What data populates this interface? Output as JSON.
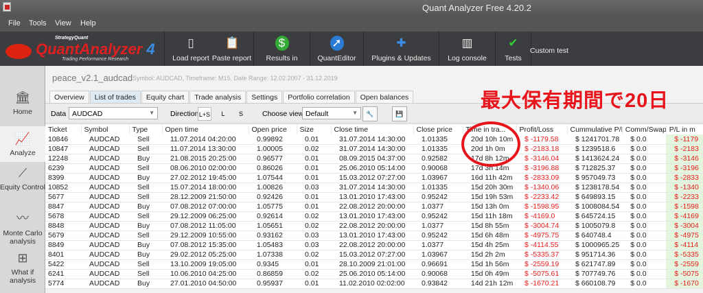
{
  "window": {
    "title": "Quant Analyzer Free 4.20.2"
  },
  "menu": [
    "File",
    "Tools",
    "View",
    "Help"
  ],
  "logo": {
    "top": "StrategyQuant",
    "main": "QuantAnalyzer",
    "version": "4",
    "sub": "Trading Performance   Research"
  },
  "toolbar": [
    {
      "label": "Load report",
      "icon": "load-report-icon"
    },
    {
      "label": "Paste report",
      "icon": "paste-report-icon"
    },
    {
      "label": "Results in",
      "icon": "dollar-icon"
    },
    {
      "label": "QuantEditor",
      "icon": "compass-icon"
    },
    {
      "label": "Plugins & Updates",
      "icon": "puzzle-icon"
    },
    {
      "label": "Log console",
      "icon": "book-icon"
    },
    {
      "label": "Tests",
      "icon": "checkmark-icon"
    }
  ],
  "custom_test": "Custom test",
  "sidebar": [
    {
      "label": "Home",
      "icon": "bank-icon"
    },
    {
      "label": "Analyze",
      "icon": "chart-icon",
      "selected": true
    },
    {
      "label": "Equity Control",
      "icon": "equity-icon"
    },
    {
      "label": "Monte Carlo analysis",
      "icon": "monte-carlo-icon"
    },
    {
      "label": "What if analysis",
      "icon": "hierarchy-icon"
    }
  ],
  "report": {
    "name": "peace_v2.1_audcad",
    "meta": "Symbol: AUDCAD, Timeframe: M15, Date Range: 12.02.2007 - 31.12.2019"
  },
  "tabs": [
    "Overview",
    "List of trades",
    "Equity chart",
    "Trade analysis",
    "Settings",
    "Portfolio correlation",
    "Open balances"
  ],
  "active_tab": "List of trades",
  "filters": {
    "data_label": "Data",
    "data_value": "AUDCAD",
    "direction_label": "Direction",
    "directions": [
      "L+S",
      "L",
      "S"
    ],
    "view_label": "Choose view",
    "view_value": "Default"
  },
  "annotation": {
    "text": "最大保有期間で20日",
    "color": "#e8141c"
  },
  "table": {
    "columns": [
      "Ticket",
      "Symbol",
      "Type",
      "Open time",
      "Open price",
      "Size",
      "Close time",
      "Close price",
      "Time in tra...",
      "Profit/Loss",
      "Cummulative P/L",
      "Comm/Swap",
      "P/L in m"
    ],
    "sort_indicator": "1",
    "rows": [
      [
        "10846",
        "AUDCAD",
        "Sell",
        "11.07.2014 04:20:00",
        "0.99892",
        "0.01",
        "31.07.2014 14:30:00",
        "1.01335",
        "20d 10h 10m",
        "$ -1179.58",
        "$ 1241701.78",
        "$ 0.0",
        "$ -1179"
      ],
      [
        "10847",
        "AUDCAD",
        "Sell",
        "11.07.2014 13:30:00",
        "1.00005",
        "0.02",
        "31.07.2014 14:30:00",
        "1.01335",
        "20d 1h 0m",
        "$ -2183.18",
        "$ 1239518.6",
        "$ 0.0",
        "$ -2183"
      ],
      [
        "12248",
        "AUDCAD",
        "Buy",
        "21.08.2015 20:25:00",
        "0.96577",
        "0.01",
        "08.09.2015 04:37:00",
        "0.92582",
        "17d 8h 12m",
        "$ -3146.04",
        "$ 1413624.24",
        "$ 0.0",
        "$ -3146"
      ],
      [
        "6239",
        "AUDCAD",
        "Sell",
        "08.06.2010 02:00:00",
        "0.86026",
        "0.01",
        "25.06.2010 05:14:00",
        "0.90068",
        "17d 3h 14m",
        "$ -3196.88",
        "$ 712825.37",
        "$ 0.0",
        "$ -3196"
      ],
      [
        "8399",
        "AUDCAD",
        "Buy",
        "27.02.2012 19:45:00",
        "1.07544",
        "0.01",
        "15.03.2012 07:27:00",
        "1.03967",
        "16d 11h 42m",
        "$ -2833.09",
        "$ 957049.73",
        "$ 0.0",
        "$ -2833"
      ],
      [
        "10852",
        "AUDCAD",
        "Sell",
        "15.07.2014 18:00:00",
        "1.00826",
        "0.03",
        "31.07.2014 14:30:00",
        "1.01335",
        "15d 20h 30m",
        "$ -1340.06",
        "$ 1238178.54",
        "$ 0.0",
        "$ -1340"
      ],
      [
        "5677",
        "AUDCAD",
        "Sell",
        "28.12.2009 21:50:00",
        "0.92426",
        "0.01",
        "13.01.2010 17:43:00",
        "0.95242",
        "15d 19h 53m",
        "$ -2233.42",
        "$ 649893.15",
        "$ 0.0",
        "$ -2233"
      ],
      [
        "8847",
        "AUDCAD",
        "Buy",
        "07.08.2012 07:00:00",
        "1.05775",
        "0.01",
        "22.08.2012 20:00:00",
        "1.0377",
        "15d 13h 0m",
        "$ -1598.95",
        "$ 1008084.54",
        "$ 0.0",
        "$ -1598"
      ],
      [
        "5678",
        "AUDCAD",
        "Sell",
        "29.12.2009 06:25:00",
        "0.92614",
        "0.02",
        "13.01.2010 17:43:00",
        "0.95242",
        "15d 11h 18m",
        "$ -4169.0",
        "$ 645724.15",
        "$ 0.0",
        "$ -4169"
      ],
      [
        "8848",
        "AUDCAD",
        "Buy",
        "07.08.2012 11:05:00",
        "1.05651",
        "0.02",
        "22.08.2012 20:00:00",
        "1.0377",
        "15d 8h 55m",
        "$ -3004.74",
        "$ 1005079.8",
        "$ 0.0",
        "$ -3004"
      ],
      [
        "5679",
        "AUDCAD",
        "Sell",
        "29.12.2009 10:55:00",
        "0.93162",
        "0.03",
        "13.01.2010 17:43:00",
        "0.95242",
        "15d 6h 48m",
        "$ -4975.75",
        "$ 640748.4",
        "$ 0.0",
        "$ -4975"
      ],
      [
        "8849",
        "AUDCAD",
        "Buy",
        "07.08.2012 15:35:00",
        "1.05483",
        "0.03",
        "22.08.2012 20:00:00",
        "1.0377",
        "15d 4h 25m",
        "$ -4114.55",
        "$ 1000965.25",
        "$ 0.0",
        "$ -4114"
      ],
      [
        "8401",
        "AUDCAD",
        "Buy",
        "29.02.2012 05:25:00",
        "1.07338",
        "0.02",
        "15.03.2012 07:27:00",
        "1.03967",
        "15d 2h 2m",
        "$ -5335.37",
        "$ 951714.36",
        "$ 0.0",
        "$ -5335"
      ],
      [
        "5422",
        "AUDCAD",
        "Sell",
        "13.10.2009 19:05:00",
        "0.9345",
        "0.01",
        "28.10.2009 21:01:00",
        "0.96691",
        "15d 1h 56m",
        "$ -2559.19",
        "$ 621747.89",
        "$ 0.0",
        "$ -2559"
      ],
      [
        "6241",
        "AUDCAD",
        "Sell",
        "10.06.2010 04:25:00",
        "0.86859",
        "0.02",
        "25.06.2010 05:14:00",
        "0.90068",
        "15d 0h 49m",
        "$ -5075.61",
        "$ 707749.76",
        "$ 0.0",
        "$ -5075"
      ],
      [
        "5774",
        "AUDCAD",
        "Buy",
        "27.01.2010 04:50:00",
        "0.95937",
        "0.01",
        "11.02.2010 02:02:00",
        "0.93842",
        "14d 21h 12m",
        "$ -1670.21",
        "$ 660108.79",
        "$ 0.0",
        "$ -1670"
      ]
    ]
  }
}
